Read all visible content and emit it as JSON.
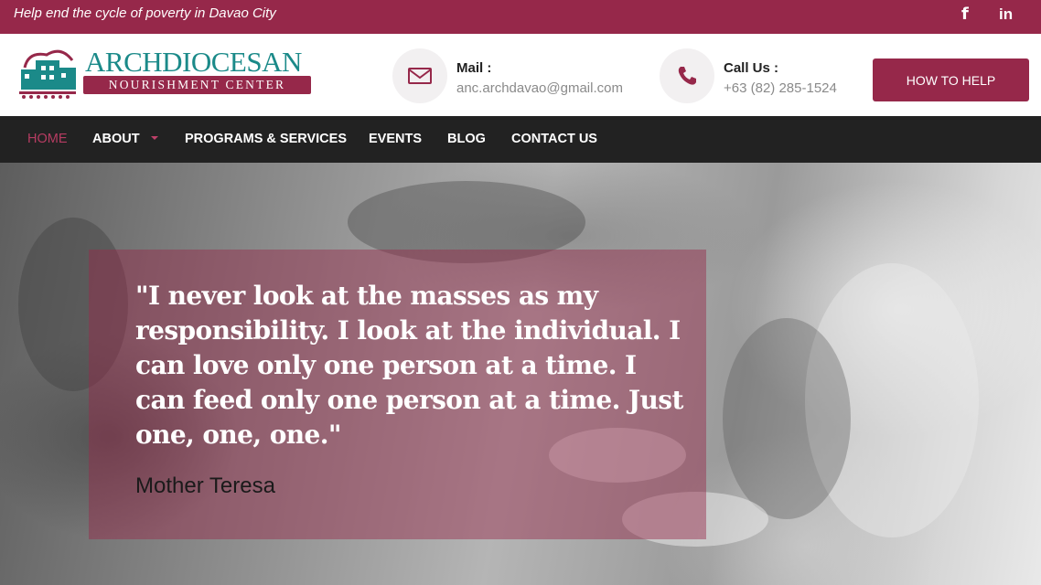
{
  "topbar": {
    "tagline": "Help end the cycle of poverty in Davao City",
    "social": {
      "facebook_icon": "f",
      "linkedin_icon": "in"
    }
  },
  "header": {
    "logo": {
      "title": "ARCHDIOCESAN",
      "subtitle": "NOURISHMENT CENTER"
    },
    "mail": {
      "label": "Mail :",
      "value": "anc.archdavao@gmail.com",
      "icon": "envelope-icon"
    },
    "phone": {
      "label": "Call Us :",
      "value": "+63 (82) 285-1524",
      "icon": "phone-icon"
    },
    "cta_label": "HOW TO HELP"
  },
  "nav": {
    "items": [
      {
        "label": "HOME",
        "active": true
      },
      {
        "label": "ABOUT",
        "has_dropdown": true
      },
      {
        "label": "PROGRAMS & SERVICES"
      },
      {
        "label": "EVENTS"
      },
      {
        "label": "BLOG"
      },
      {
        "label": "CONTACT US"
      }
    ]
  },
  "hero": {
    "quote": "\"I never look at the masses as my responsibility. I look at the individual. I can love only one person at a time. I can feed only one person at a time. Just one, one, one.\"",
    "author": "Mother Teresa"
  },
  "colors": {
    "brand": "#96284a",
    "teal": "#1b8a89",
    "nav_bg": "#222222"
  }
}
